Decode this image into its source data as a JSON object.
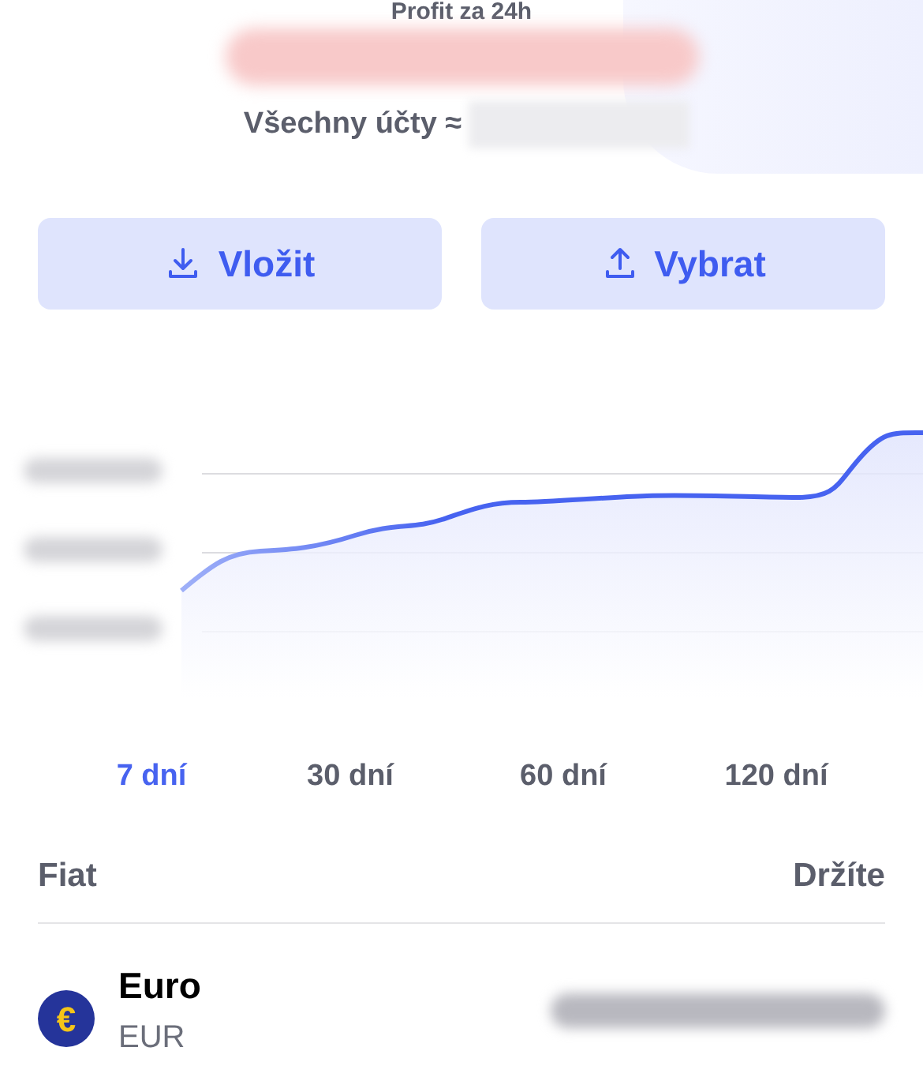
{
  "summary": {
    "profit_label": "Profit za 24h",
    "all_accounts_label": "Všechny účty ≈"
  },
  "actions": [
    {
      "kind": "deposit",
      "label": "Vložit"
    },
    {
      "kind": "withdraw",
      "label": "Vybrat"
    }
  ],
  "periods": [
    {
      "label": "7 dní",
      "selected": true
    },
    {
      "label": "30 dní",
      "selected": false
    },
    {
      "label": "60 dní",
      "selected": false
    },
    {
      "label": "120 dní",
      "selected": false
    }
  ],
  "holdings": {
    "columns": [
      "Fiat",
      "Držíte"
    ],
    "rows": [
      {
        "name": "Euro",
        "code": "EUR",
        "symbol": "€"
      }
    ]
  }
}
